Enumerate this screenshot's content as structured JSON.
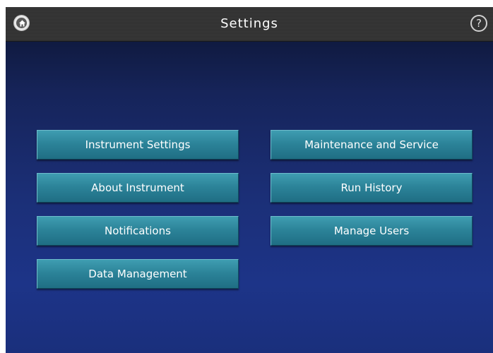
{
  "header": {
    "title": "Settings",
    "home_icon": "home-icon",
    "help_icon": "help-icon",
    "help_glyph": "?"
  },
  "menu": {
    "left": [
      {
        "label": "Instrument Settings"
      },
      {
        "label": "About Instrument"
      },
      {
        "label": "Notifications"
      },
      {
        "label": "Data Management"
      }
    ],
    "right": [
      {
        "label": "Maintenance and Service"
      },
      {
        "label": "Run History"
      },
      {
        "label": "Manage Users"
      }
    ]
  },
  "colors": {
    "background_top": "#0c1430",
    "background_bottom": "#1d3488",
    "button_fill": "#2c8499",
    "topbar": "#333333"
  }
}
